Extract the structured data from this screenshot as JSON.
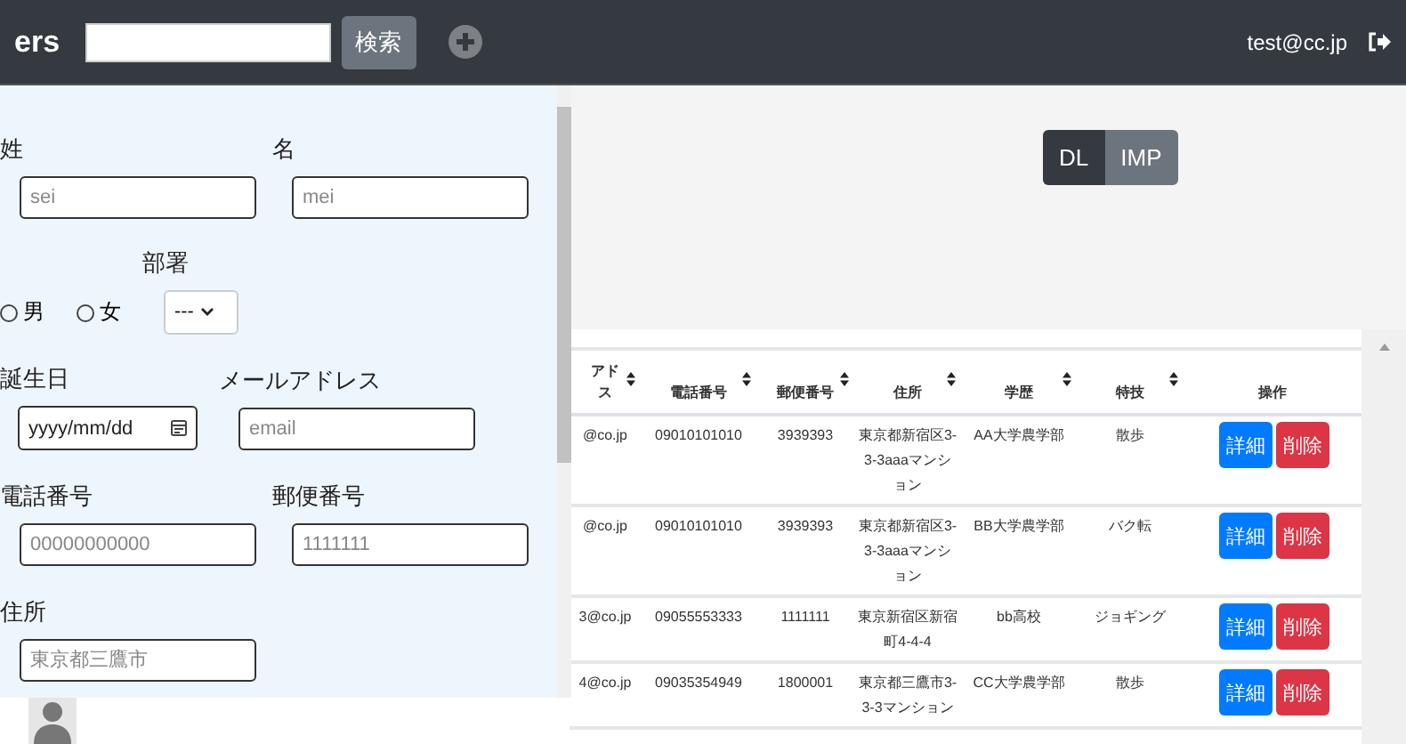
{
  "header": {
    "brand": "ers",
    "search_button": "検索",
    "user": "test@cc.jp"
  },
  "form": {
    "rows": [
      [
        {
          "kind": "text",
          "label": "姓",
          "placeholder": "sei"
        },
        {
          "kind": "text",
          "label": "名",
          "placeholder": "mei"
        }
      ],
      [
        {
          "kind": "radios",
          "options": [
            {
              "label": "男",
              "selected": false
            },
            {
              "label": "女",
              "selected": false
            }
          ]
        },
        {
          "kind": "select",
          "label": "部署",
          "value": "---"
        }
      ],
      [
        {
          "kind": "date",
          "label": "誕生日",
          "placeholder": "yyyy/mm/dd"
        },
        {
          "kind": "text",
          "label": "メールアドレス",
          "placeholder": "email"
        }
      ],
      [
        {
          "kind": "text",
          "label": "電話番号",
          "placeholder": "00000000000"
        },
        {
          "kind": "text",
          "label": "郵便番号",
          "placeholder": "1111111"
        }
      ],
      [
        {
          "kind": "text",
          "label": "住所",
          "placeholder": "東京都三鷹市"
        }
      ]
    ]
  },
  "toolbar": [
    {
      "label": "DL",
      "selected": true
    },
    {
      "label": "IMP",
      "selected": false
    }
  ],
  "table": {
    "columns": [
      {
        "label": "アドス",
        "sortable": true
      },
      {
        "label": "電話番号",
        "sortable": true
      },
      {
        "label": "郵便番号",
        "sortable": true
      },
      {
        "label": "住所",
        "sortable": true
      },
      {
        "label": "学歴",
        "sortable": true
      },
      {
        "label": "特技",
        "sortable": true
      },
      {
        "label": "操作",
        "sortable": false
      }
    ],
    "rows": [
      {
        "cells": [
          "@co.jp",
          "09010101010",
          "3939393",
          "東京都新宿区3-3-3aaaマンション",
          "AA大学農学部",
          "散歩"
        ],
        "actions": [
          "詳細",
          "削除"
        ]
      },
      {
        "cells": [
          "@co.jp",
          "09010101010",
          "3939393",
          "東京都新宿区3-3-3aaaマンション",
          "BB大学農学部",
          "バク転"
        ],
        "actions": [
          "詳細",
          "削除"
        ]
      },
      {
        "cells": [
          "3@co.jp",
          "09055553333",
          "1111111",
          "東京新宿区新宿町4-4-4",
          "bb高校",
          "ジョギング"
        ],
        "actions": [
          "詳細",
          "削除"
        ]
      },
      {
        "cells": [
          "4@co.jp",
          "09035354949",
          "1800001",
          "東京都三鷹市3-3-3マンション",
          "CC大学農学部",
          "散歩"
        ],
        "actions": [
          "詳細",
          "削除"
        ]
      }
    ]
  }
}
